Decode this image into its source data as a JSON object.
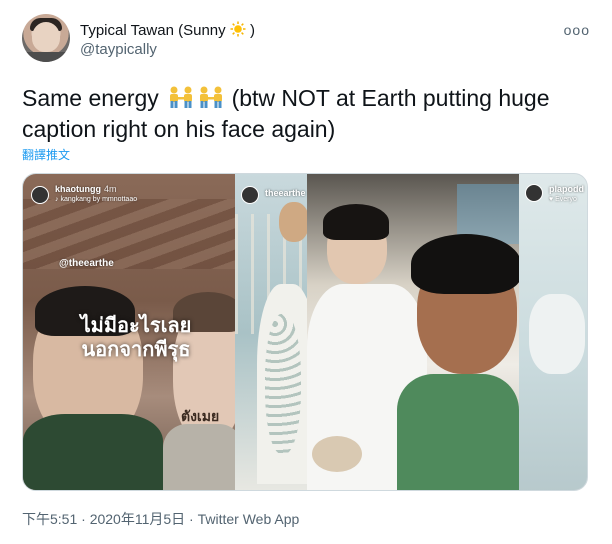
{
  "user": {
    "display_name": "Typical Tawan (Sunny",
    "display_suffix": ")",
    "handle": "@taypically"
  },
  "more_label": "ooo",
  "tweet": {
    "text_before": "Same energy",
    "text_after": " (btw NOT at Earth putting huge caption right on his face again)",
    "translate_label": "翻譯推文"
  },
  "media": {
    "stories": [
      {
        "username": "khaotungg",
        "time": "4m",
        "subline": "♪ kangkang by mmnottaao"
      },
      {
        "username": "theearthe"
      },
      {
        "username": "plapodd",
        "subline": "♥ Everyo"
      }
    ],
    "mention": "@theearthe",
    "thai_caption_line1": "ไม่มีอะไรเลย",
    "thai_caption_line2": "นอกจากพีรุธ",
    "sign_text": "ตังเมย"
  },
  "meta": {
    "timestamp": "下午5:51 · 2020年11月5日 · Twitter Web App"
  },
  "colors": {
    "link": "#1d9bf0",
    "secondary_text": "#536471",
    "primary_text": "#0f1419",
    "border": "#cfd9de"
  }
}
